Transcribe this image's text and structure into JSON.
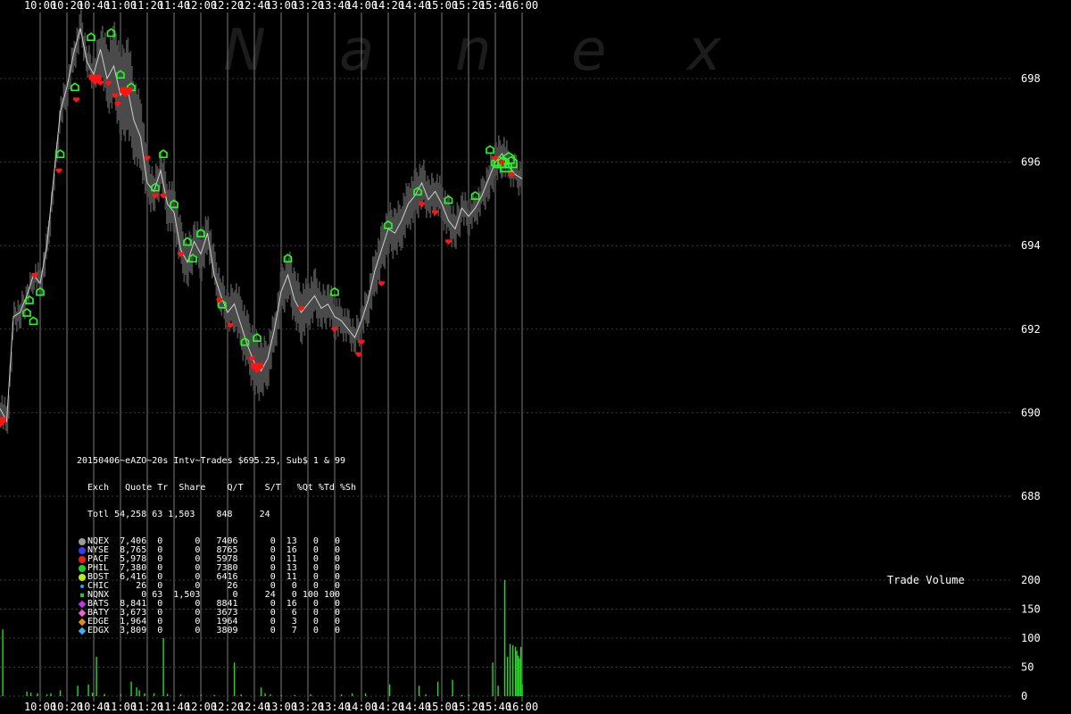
{
  "chart_data": [
    {
      "type": "line",
      "watermark_letters": [
        "N",
        "a",
        "n",
        "e",
        "x"
      ],
      "x_tick_labels": [
        "10:00",
        "10:20",
        "10:40",
        "11:00",
        "11:20",
        "11:40",
        "12:00",
        "12:20",
        "12:40",
        "13:00",
        "13:20",
        "13:40",
        "14:00",
        "14:20",
        "14:40",
        "15:00",
        "15:20",
        "15:40",
        "16:00"
      ],
      "ylim": [
        686,
        700
      ],
      "y_ticks": [
        688,
        690,
        692,
        694,
        696,
        698
      ],
      "grid": true,
      "price_path": [
        [
          "09:30",
          690.1
        ],
        [
          "09:35",
          689.8
        ],
        [
          "09:40",
          692.3
        ],
        [
          "09:45",
          692.4
        ],
        [
          "09:50",
          692.8
        ],
        [
          "09:55",
          693.3
        ],
        [
          "10:00",
          693.1
        ],
        [
          "10:05",
          694.0
        ],
        [
          "10:10",
          695.6
        ],
        [
          "10:15",
          697.2
        ],
        [
          "10:20",
          697.8
        ],
        [
          "10:25",
          698.6
        ],
        [
          "10:30",
          699.2
        ],
        [
          "10:35",
          698.4
        ],
        [
          "10:40",
          698.1
        ],
        [
          "10:45",
          698.7
        ],
        [
          "10:50",
          698.0
        ],
        [
          "10:55",
          698.3
        ],
        [
          "11:00",
          697.6
        ],
        [
          "11:05",
          697.8
        ],
        [
          "11:10",
          697.0
        ],
        [
          "11:15",
          696.6
        ],
        [
          "11:20",
          695.5
        ],
        [
          "11:25",
          695.3
        ],
        [
          "11:30",
          695.8
        ],
        [
          "11:35",
          695.0
        ],
        [
          "11:40",
          694.8
        ],
        [
          "11:45",
          693.9
        ],
        [
          "11:50",
          693.6
        ],
        [
          "11:55",
          694.1
        ],
        [
          "12:00",
          693.8
        ],
        [
          "12:05",
          694.3
        ],
        [
          "12:10",
          693.3
        ],
        [
          "12:15",
          692.8
        ],
        [
          "12:20",
          692.4
        ],
        [
          "12:25",
          692.6
        ],
        [
          "12:30",
          692.1
        ],
        [
          "12:35",
          691.6
        ],
        [
          "12:40",
          691.2
        ],
        [
          "12:45",
          691.0
        ],
        [
          "12:50",
          691.3
        ],
        [
          "12:55",
          692.0
        ],
        [
          "13:00",
          692.9
        ],
        [
          "13:05",
          693.3
        ],
        [
          "13:10",
          692.7
        ],
        [
          "13:15",
          692.4
        ],
        [
          "13:20",
          692.6
        ],
        [
          "13:25",
          692.8
        ],
        [
          "13:30",
          692.5
        ],
        [
          "13:35",
          692.6
        ],
        [
          "13:40",
          692.3
        ],
        [
          "13:45",
          692.2
        ],
        [
          "13:50",
          692.0
        ],
        [
          "13:55",
          691.8
        ],
        [
          "14:00",
          692.2
        ],
        [
          "14:05",
          692.7
        ],
        [
          "14:10",
          693.4
        ],
        [
          "14:15",
          693.9
        ],
        [
          "14:20",
          694.4
        ],
        [
          "14:25",
          694.3
        ],
        [
          "14:30",
          694.6
        ],
        [
          "14:35",
          695.0
        ],
        [
          "14:40",
          695.2
        ],
        [
          "14:45",
          695.5
        ],
        [
          "14:50",
          695.1
        ],
        [
          "14:55",
          695.3
        ],
        [
          "15:00",
          695.0
        ],
        [
          "15:05",
          694.6
        ],
        [
          "15:10",
          694.4
        ],
        [
          "15:15",
          694.9
        ],
        [
          "15:20",
          694.7
        ],
        [
          "15:25",
          694.9
        ],
        [
          "15:30",
          695.2
        ],
        [
          "15:35",
          695.6
        ],
        [
          "15:40",
          696.0
        ],
        [
          "15:45",
          696.2
        ],
        [
          "15:50",
          695.9
        ],
        [
          "15:55",
          695.7
        ],
        [
          "16:00",
          695.6
        ]
      ],
      "quote_band_halfwidth": [
        0.3,
        0.3,
        0.2,
        0.3,
        0.2,
        0.2,
        0.3,
        0.3,
        0.2,
        0.3,
        0.3,
        0.3,
        0.3,
        0.3,
        0.3,
        0.6,
        0.7,
        0.9,
        1.0,
        1.1,
        0.9,
        0.8,
        0.5,
        0.4,
        0.4,
        0.5,
        0.5,
        0.5,
        0.5,
        0.4,
        0.5,
        0.4,
        0.4,
        0.4,
        0.4,
        0.5,
        0.6,
        0.6,
        0.7,
        0.6,
        0.5,
        0.4,
        0.5,
        0.5,
        0.6,
        0.6,
        0.5,
        0.5,
        0.4,
        0.4,
        0.4,
        0.3,
        0.3,
        0.3,
        0.3,
        0.4,
        0.5,
        0.5,
        0.5,
        0.5,
        0.5,
        0.5,
        0.5,
        0.5,
        0.4,
        0.4,
        0.4,
        0.4,
        0.4,
        0.3,
        0.3,
        0.3,
        0.3,
        0.4,
        0.4,
        0.4,
        0.3,
        0.3,
        0.3
      ],
      "up_markers": [
        [
          "09:50",
          692.4
        ],
        [
          "09:52",
          692.7
        ],
        [
          "09:55",
          692.2
        ],
        [
          "10:00",
          692.9
        ],
        [
          "10:15",
          696.2
        ],
        [
          "10:26",
          697.8
        ],
        [
          "10:38",
          699.0
        ],
        [
          "10:53",
          699.1
        ],
        [
          "11:00",
          698.1
        ],
        [
          "11:08",
          697.8
        ],
        [
          "11:26",
          695.4
        ],
        [
          "11:32",
          696.2
        ],
        [
          "11:40",
          695.0
        ],
        [
          "11:50",
          694.1
        ],
        [
          "11:54",
          693.7
        ],
        [
          "12:00",
          694.3
        ],
        [
          "12:16",
          692.6
        ],
        [
          "12:33",
          691.7
        ],
        [
          "12:42",
          691.8
        ],
        [
          "13:05",
          693.7
        ],
        [
          "13:40",
          692.9
        ],
        [
          "14:20",
          694.5
        ],
        [
          "14:42",
          695.3
        ],
        [
          "15:05",
          695.1
        ],
        [
          "15:25",
          695.2
        ],
        [
          "15:36",
          696.3
        ],
        [
          "15:40",
          696.0
        ],
        [
          "15:43",
          696.0
        ],
        [
          "15:46",
          696.0
        ],
        [
          "15:48",
          695.9
        ],
        [
          "15:50",
          696.1
        ],
        [
          "15:52",
          696.0
        ]
      ],
      "down_markers": [
        [
          "09:30",
          689.8
        ],
        [
          "09:56",
          693.3
        ],
        [
          "10:14",
          695.8
        ],
        [
          "10:27",
          697.5
        ],
        [
          "10:41",
          698.0
        ],
        [
          "10:45",
          697.9
        ],
        [
          "10:51",
          697.9
        ],
        [
          "10:56",
          697.6
        ],
        [
          "10:58",
          697.4
        ],
        [
          "11:02",
          697.7
        ],
        [
          "11:04",
          697.7
        ],
        [
          "11:20",
          696.1
        ],
        [
          "11:26",
          695.2
        ],
        [
          "11:32",
          695.2
        ],
        [
          "11:45",
          693.8
        ],
        [
          "12:14",
          692.7
        ],
        [
          "12:22",
          692.1
        ],
        [
          "12:38",
          691.3
        ],
        [
          "12:42",
          691.1
        ],
        [
          "13:15",
          692.5
        ],
        [
          "13:40",
          692.0
        ],
        [
          "13:58",
          691.4
        ],
        [
          "14:00",
          691.7
        ],
        [
          "14:15",
          693.1
        ],
        [
          "14:45",
          695.0
        ],
        [
          "14:55",
          694.8
        ],
        [
          "15:05",
          694.1
        ],
        [
          "15:40",
          696.1
        ],
        [
          "15:45",
          696.0
        ],
        [
          "15:52",
          695.7
        ]
      ]
    },
    {
      "type": "bar",
      "title": "Trade Volume",
      "ylim": [
        0,
        200
      ],
      "y_ticks": [
        0,
        50,
        100,
        150,
        200
      ],
      "bars": [
        [
          "09:32",
          115
        ],
        [
          "09:50",
          8
        ],
        [
          "09:53",
          6
        ],
        [
          "09:58",
          5
        ],
        [
          "10:05",
          3
        ],
        [
          "10:08",
          5
        ],
        [
          "10:15",
          10
        ],
        [
          "10:28",
          18
        ],
        [
          "10:36",
          20
        ],
        [
          "10:39",
          6
        ],
        [
          "10:42",
          68
        ],
        [
          "10:48",
          4
        ],
        [
          "11:00",
          4
        ],
        [
          "11:08",
          25
        ],
        [
          "11:12",
          15
        ],
        [
          "11:14",
          10
        ],
        [
          "11:18",
          5
        ],
        [
          "11:25",
          5
        ],
        [
          "11:32",
          100
        ],
        [
          "11:35",
          4
        ],
        [
          "11:45",
          3
        ],
        [
          "12:00",
          3
        ],
        [
          "12:10",
          2
        ],
        [
          "12:25",
          58
        ],
        [
          "12:30",
          3
        ],
        [
          "12:45",
          15
        ],
        [
          "12:48",
          5
        ],
        [
          "12:52",
          3
        ],
        [
          "13:00",
          2
        ],
        [
          "13:10",
          2
        ],
        [
          "13:22",
          3
        ],
        [
          "13:45",
          3
        ],
        [
          "13:53",
          5
        ],
        [
          "14:03",
          5
        ],
        [
          "14:21",
          20
        ],
        [
          "14:43",
          18
        ],
        [
          "14:48",
          3
        ],
        [
          "14:57",
          25
        ],
        [
          "15:08",
          28
        ],
        [
          "15:15",
          2
        ],
        [
          "15:20",
          3
        ],
        [
          "15:38",
          58
        ],
        [
          "15:42",
          18
        ],
        [
          "15:47",
          200
        ],
        [
          "15:49",
          68
        ],
        [
          "15:51",
          90
        ],
        [
          "15:53",
          88
        ],
        [
          "15:55",
          85
        ],
        [
          "15:56",
          78
        ],
        [
          "15:57",
          70
        ],
        [
          "15:58",
          65
        ],
        [
          "15:59",
          85
        ],
        [
          "16:00",
          20
        ]
      ]
    }
  ],
  "stats_table": {
    "title": "20150406~eAZO~20s Intv~Trades $695.25, Sub$ 1 & 99",
    "header": "Exch   Quote Tr  Share    Q/T    S/T   %Qt %Td %Sh",
    "total": "Totl 54,258 63 1,503    848     24",
    "rows": [
      {
        "symbol": "dot",
        "color": "#9a9a9a",
        "text": "NQEX  7,406  0      0   7406      0  13   0   0"
      },
      {
        "symbol": "dot",
        "color": "#3a3af0",
        "text": "NYSE  8,765  0      0   8765      0  16   0   0"
      },
      {
        "symbol": "dot",
        "color": "#ee1c1c",
        "text": "PACF  5,978  0      0   5978      0  11   0   0"
      },
      {
        "symbol": "dot",
        "color": "#22cc22",
        "text": "PHIL  7,380  0      0   7380      0  13   0   0"
      },
      {
        "symbol": "dot",
        "color": "#b4f020",
        "text": "BOST  6,416  0      0   6416      0  11   0   0"
      },
      {
        "symbol": "smalldot",
        "color": "#22a8e8",
        "text": "CHIC     26  0      0     26      0   0   0   0"
      },
      {
        "symbol": "sq",
        "color": "#22cc22",
        "text": "NQNX      0 63  1,503      0     24   0 100 100"
      },
      {
        "symbol": "diamond",
        "color": "#cc33ee",
        "text": "BATS  8,841  0      0   8841      0  16   0   0"
      },
      {
        "symbol": "diamond",
        "color": "#ee66cc",
        "text": "BATY  3,673  0      0   3673      0   6   0   0"
      },
      {
        "symbol": "diamond",
        "color": "#e88a20",
        "text": "EDGE  1,964  0      0   1964      0   3   0   0"
      },
      {
        "symbol": "diamond",
        "color": "#40b0ee",
        "text": "EDGX  3,809  0      0   3809      0   7   0   0"
      }
    ]
  },
  "colors": {
    "background": "#000000",
    "grid": "#3a3a3a",
    "quote_band": "#4a4a4a",
    "price_line": "#cfcfcf",
    "up_marker": "#22ff22",
    "down_marker": "#ff1414",
    "volume_bar": "#22dd22"
  }
}
